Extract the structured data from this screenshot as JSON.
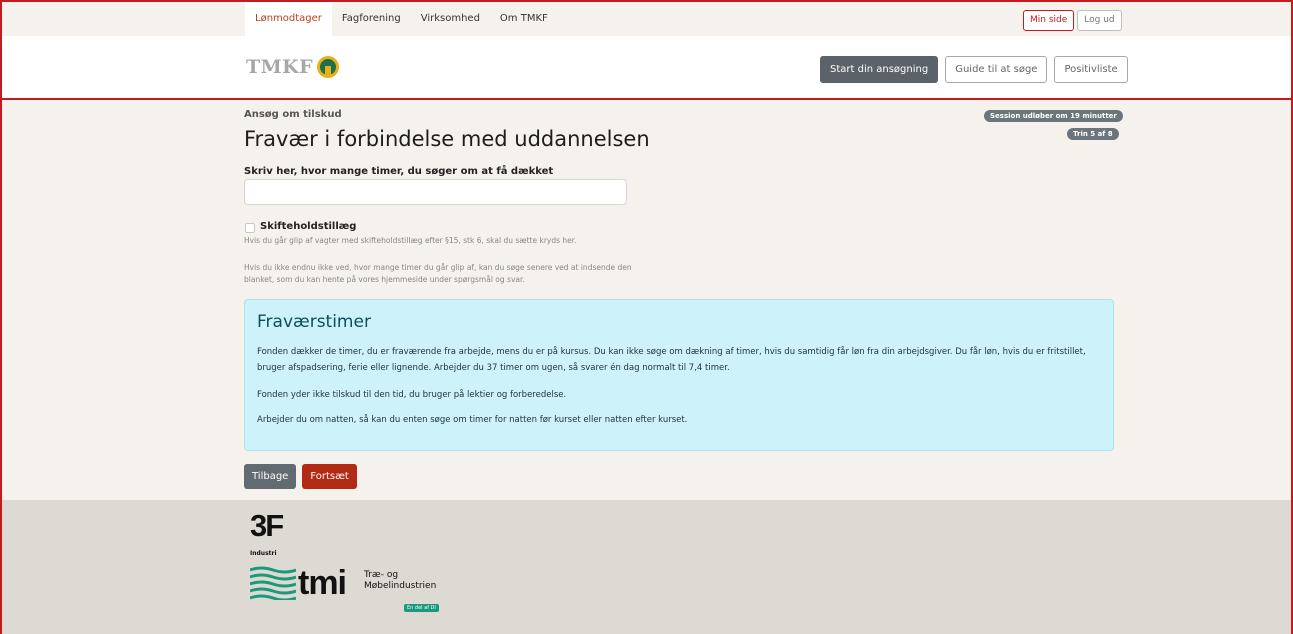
{
  "topnav": {
    "items": [
      "Lønmodtager",
      "Fagforening",
      "Virksomhed",
      "Om TMKF"
    ],
    "min_side": "Min side",
    "log_ud": "Log ud"
  },
  "brand": {
    "logo_text": "TMKF"
  },
  "header_actions": {
    "start": "Start din ansøgning",
    "guide": "Guide til at søge",
    "positivliste": "Positivliste"
  },
  "page": {
    "eyebrow": "Ansøg om tilskud",
    "title": "Fravær i forbindelse med uddannelsen",
    "session_badge": "Session udløber om 19 minutter",
    "step_badge": "Trin 5 af 8"
  },
  "form": {
    "hours_label": "Skriv her, hvor mange timer, du søger om at få dækket",
    "hours_value": "",
    "shift_label": "Skifteholdstillæg",
    "shift_help": "Hvis du går glip af vagter med skifteholdstillæg efter §15, stk 6, skal du sætte kryds her.",
    "unknown_help": "Hvis du ikke endnu ikke ved, hvor mange timer du går glip af, kan du søge senere ved at indsende den blanket, som du kan hente på vores hjemmeside under spørgsmål og svar."
  },
  "info": {
    "heading": "Fraværstimer",
    "p1": "Fonden dækker de timer, du er fraværende fra arbejde, mens du er på kursus. Du kan ikke søge om dækning af timer, hvis du samtidig får løn fra din arbejdsgiver. Du får løn, hvis du er fritstillet, bruger afspadsering, ferie eller lignende. Arbejder du 37 timer om ugen, så svarer én dag normalt til 7,4 timer.",
    "p2": "Fonden yder ikke tilskud til den tid, du bruger på lektier og forberedelse.",
    "p3": "Arbejder du om natten, så kan du enten søge om timer for natten før kurset eller natten efter kurset."
  },
  "buttons": {
    "back": "Tilbage",
    "next": "Fortsæt"
  },
  "footer": {
    "logo_3f": "3F",
    "logo_3f_sub": "Industri",
    "tmi": "tmi",
    "tmi_sub1": "Træ- og",
    "tmi_sub2": "Møbelindustrien",
    "tmi_tag": "En del af DI"
  }
}
